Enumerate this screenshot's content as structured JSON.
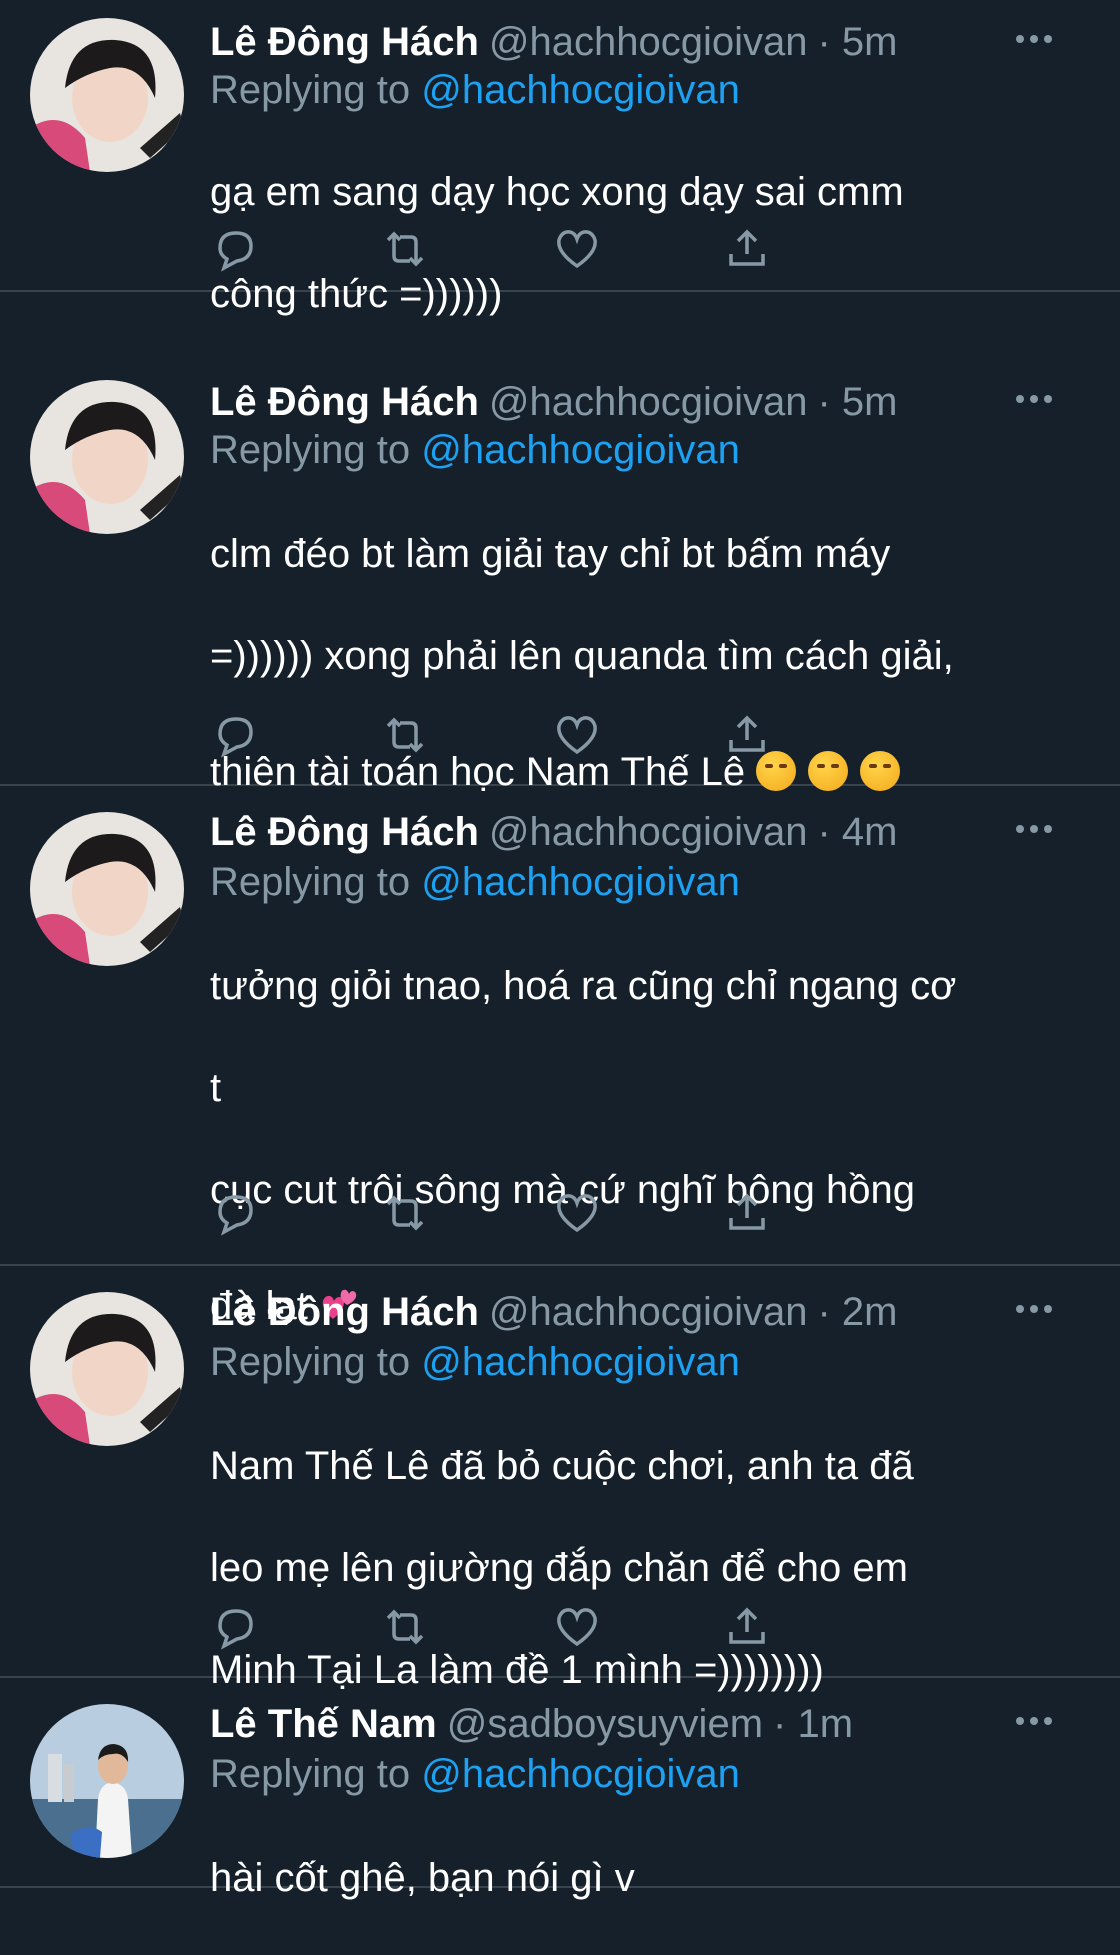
{
  "colors": {
    "background": "#15202b",
    "divider": "#38444d",
    "muted": "#8899a6",
    "link": "#1da1f2"
  },
  "tweets": [
    {
      "name": "Lê Đông Hách",
      "handle": "@hachhocgioivan",
      "time": "· 5m",
      "replying_label": "Replying to",
      "replying_to": "@hachhocgioivan",
      "lines": [
        "gạ em sang dạy học xong dạy sai cmm",
        "công thức =))))))"
      ]
    },
    {
      "name": "Lê Đông Hách",
      "handle": "@hachhocgioivan",
      "time": "· 5m",
      "replying_label": "Replying to",
      "replying_to": "@hachhocgioivan",
      "lines": [
        "clm đéo bt làm giải tay chỉ bt bấm máy",
        "=)))))) xong phải lên quanda tìm cách giải,",
        "thiên tài toán học Nam Thế Lê"
      ],
      "emoji_icons": [
        "woozy-face-icon",
        "woozy-face-icon",
        "woozy-face-icon"
      ]
    },
    {
      "name": "Lê Đông Hách",
      "handle": "@hachhocgioivan",
      "time": "· 4m",
      "replying_label": "Replying to",
      "replying_to": "@hachhocgioivan",
      "lines": [
        "tưởng giỏi tnao, hoá ra cũng chỉ ngang cơ",
        "t",
        "cục cut trôi sông mà cứ nghĩ bông hồng",
        "đà lạt"
      ],
      "emoji_icons": [
        "two-hearts-icon"
      ]
    },
    {
      "name": "Lê Đông Hách",
      "handle": "@hachhocgioivan",
      "time": "· 2m",
      "replying_label": "Replying to",
      "replying_to": "@hachhocgioivan",
      "lines": [
        "Nam Thế Lê đã bỏ cuộc chơi, anh ta đã",
        "leo mẹ lên giường đắp chăn để cho em",
        "Minh Tại La làm đề 1 mình =))))))))"
      ]
    },
    {
      "name": "Lê Thế Nam",
      "handle": "@sadboysuyviem",
      "time": "· 1m",
      "replying_label": "Replying to",
      "replying_to": "@hachhocgioivan",
      "lines": [
        "hài cốt ghê, bạn nói gì v"
      ]
    }
  ],
  "action_icons": [
    "reply-icon",
    "retweet-icon",
    "like-icon",
    "share-icon"
  ],
  "more_icon": "more-options-icon"
}
